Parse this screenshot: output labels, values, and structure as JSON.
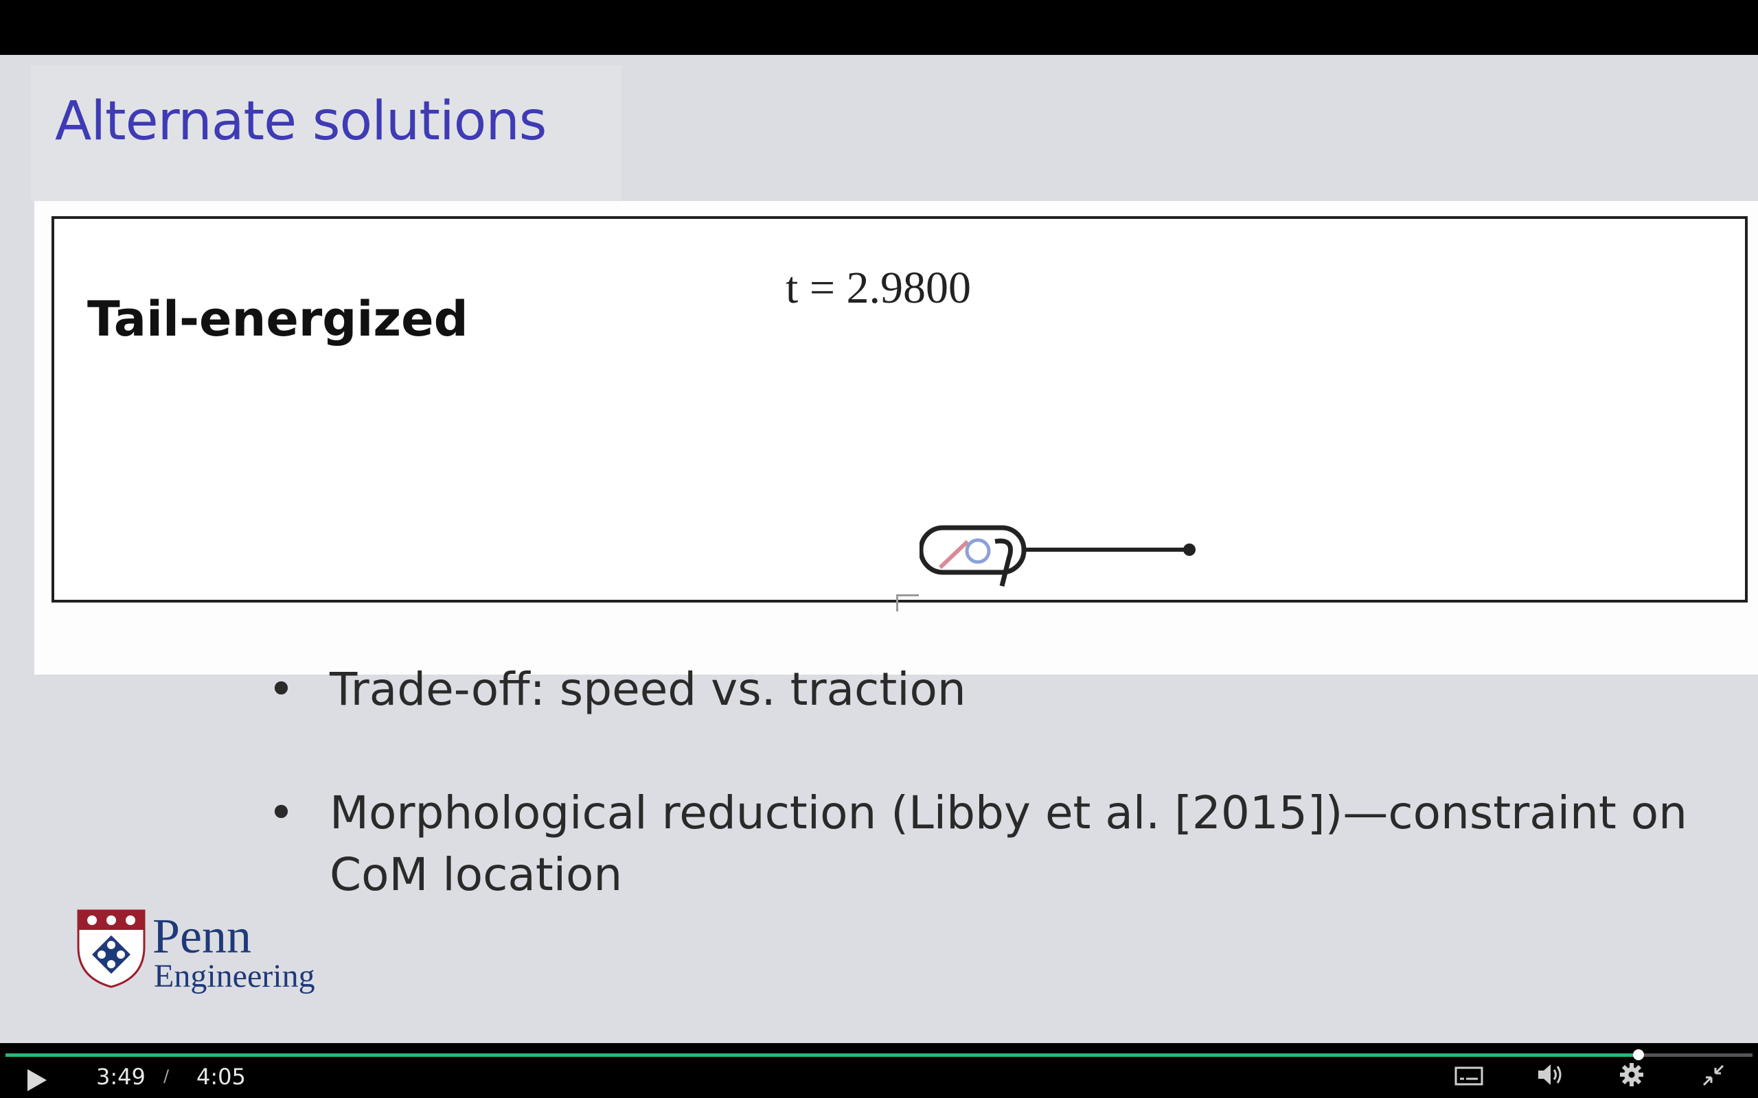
{
  "slide": {
    "title": "Alternate solutions",
    "simulation": {
      "label": "Tail-energized",
      "time_text": "t = 2.9800"
    },
    "bullets": [
      "Trade-off:  speed vs. traction",
      "Morphological reduction (Libby et al. [2015])—constraint on CoM location"
    ],
    "logo": {
      "name": "Penn",
      "subname": "Engineering"
    }
  },
  "player": {
    "current_time": "3:49",
    "separator": "/",
    "duration": "4:05",
    "progress": 0.9347,
    "colors": {
      "played": "#2fb67a",
      "track": "#555555",
      "handle": "#ffffff"
    },
    "icons": [
      "play-icon",
      "captions-icon",
      "volume-icon",
      "settings-gear-icon",
      "exit-fullscreen-icon"
    ]
  }
}
